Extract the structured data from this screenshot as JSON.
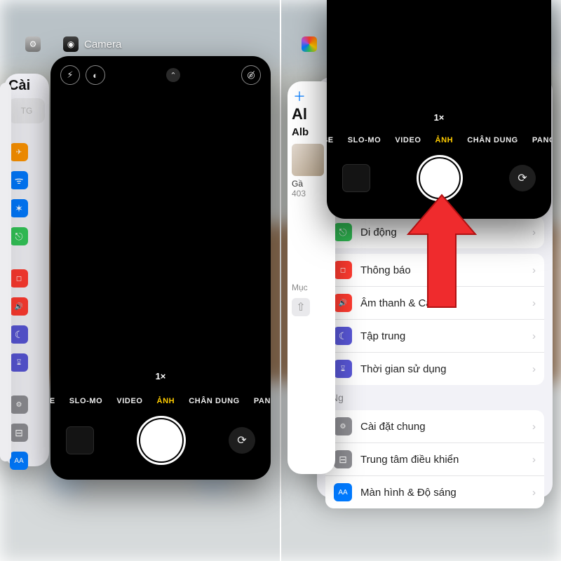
{
  "app_switcher": {
    "active_app": "Camera"
  },
  "camera": {
    "zoom": "1×",
    "modes": [
      "SLO-MO",
      "VIDEO",
      "ẢNH",
      "CHÂN DUNG",
      "PANO"
    ],
    "mode_left_clip": "SE",
    "selected_mode_index": 2
  },
  "left_panel": {
    "settings_title_clip": "Cài",
    "sidebar_chips": [
      {
        "glyph": "✈︎",
        "bg": "#ff9500"
      },
      {
        "glyph": "ᯤ",
        "bg": "#007aff"
      },
      {
        "glyph": "✶",
        "bg": "#007aff"
      },
      {
        "glyph": "⎋",
        "bg": "#34c759"
      },
      {
        "glyph": "◻︎",
        "bg": "#ff3b30"
      },
      {
        "glyph": "🔊",
        "bg": "#ff3b30"
      },
      {
        "glyph": "☾",
        "bg": "#5856d6"
      },
      {
        "glyph": "⌛︎",
        "bg": "#5856d6"
      },
      {
        "glyph": "⚙︎",
        "bg": "#8e8e93"
      },
      {
        "glyph": "⊟",
        "bg": "#8e8e93"
      },
      {
        "glyph": "AA",
        "bg": "#007aff"
      }
    ]
  },
  "right_panel": {
    "photos_title_clip": "Al",
    "album_label": "Alb",
    "album_sub1": "Gầ",
    "album_sub2": "403",
    "settings_rows_g1": [
      {
        "label": "Di động",
        "glyph": "⎋",
        "bg": "#34c759"
      }
    ],
    "settings_rows_g2": [
      {
        "label": "Thông báo",
        "glyph": "◻︎",
        "bg": "#ff3b30"
      },
      {
        "label": "Âm thanh & Cảm ứ",
        "glyph": "🔊",
        "bg": "#ff3b30"
      },
      {
        "label": "Tập trung",
        "glyph": "☾",
        "bg": "#5856d6"
      },
      {
        "label": "Thời gian sử dụng",
        "glyph": "⌛︎",
        "bg": "#5856d6"
      }
    ],
    "settings_rows_g3": [
      {
        "label": "Cài đặt chung",
        "glyph": "⚙︎",
        "bg": "#8e8e93"
      },
      {
        "label": "Trung tâm điều khiển",
        "glyph": "⊟",
        "bg": "#8e8e93"
      },
      {
        "label": "Màn hình & Độ sáng",
        "glyph": "AA",
        "bg": "#007aff"
      }
    ],
    "section_labels": {
      "muc": "Mục",
      "ng": "Ng"
    }
  },
  "colors": {
    "accent": "#ffcc00",
    "danger": "#ff3b30",
    "primary": "#007aff"
  }
}
